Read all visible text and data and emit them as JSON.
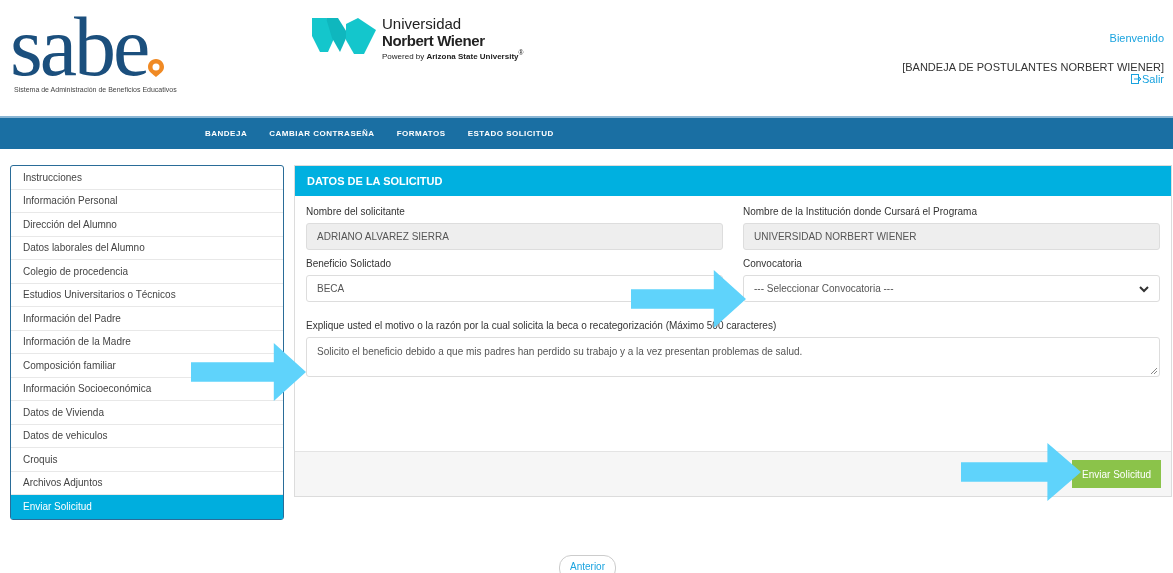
{
  "header": {
    "logo": {
      "wordmark": "sabe",
      "tagline": "Sistema de Administración de Beneficios Educativos"
    },
    "partner": {
      "line1": "Universidad",
      "line2": "Norbert Wiener",
      "powered": "Powered by **Arizona State University**$^{®}$"
    },
    "user": {
      "welcome": "Bienvenido",
      "account": "[BANDEJA DE POSTULANTES NORBERT WIENER]",
      "logout": "Salir"
    }
  },
  "nav": [
    {
      "label": "BANDEJA"
    },
    {
      "label": "CAMBIAR CONTRASEÑA"
    },
    {
      "label": "FORMATOS"
    },
    {
      "label": "ESTADO SOLICITUD"
    }
  ],
  "sidebar": {
    "items": [
      {
        "label": "Instrucciones",
        "selected": false
      },
      {
        "label": "Información Personal",
        "selected": false
      },
      {
        "label": "Dirección del Alumno",
        "selected": false
      },
      {
        "label": "Datos laborales del Alumno",
        "selected": false
      },
      {
        "label": "Colegio de procedencia",
        "selected": false
      },
      {
        "label": "Estudios Universitarios o Técnicos",
        "selected": false
      },
      {
        "label": "Información del Padre",
        "selected": false
      },
      {
        "label": "Información de la Madre",
        "selected": false
      },
      {
        "label": "Composición familiar",
        "selected": false
      },
      {
        "label": "Información Socioeconómica",
        "selected": false
      },
      {
        "label": "Datos de Vivienda",
        "selected": false
      },
      {
        "label": "Datos de vehiculos",
        "selected": false
      },
      {
        "label": "Croquis",
        "selected": false
      },
      {
        "label": "Archivos Adjuntos",
        "selected": false
      },
      {
        "label": "Enviar Solicitud",
        "selected": true
      }
    ]
  },
  "panel": {
    "title": "DATOS DE LA SOLICITUD",
    "fields": [
      {
        "kind": "readonly",
        "label": "Nombre del solicitante",
        "value": "ADRIANO ALVAREZ SIERRA"
      },
      {
        "kind": "readonly",
        "label": "Nombre de la Institución donde Cursará el Programa",
        "value": "UNIVERSIDAD NORBERT WIENER"
      },
      {
        "kind": "text",
        "label": "Beneficio Solictado",
        "value": "BECA"
      },
      {
        "kind": "select",
        "label": "Convocatoria",
        "value": "--- Seleccionar Convocatoria ---"
      },
      {
        "kind": "textarea",
        "label": "Explique usted el motivo o la razón por la cual solicita la beca o recategorización (Máximo 500 caracteres)",
        "value": "Solicito el beneficio debido  a que mis padres han perdido su trabajo y a la vez presentan problemas de salud."
      }
    ],
    "submit": "Enviar Solicitud"
  },
  "back": "Anterior"
}
